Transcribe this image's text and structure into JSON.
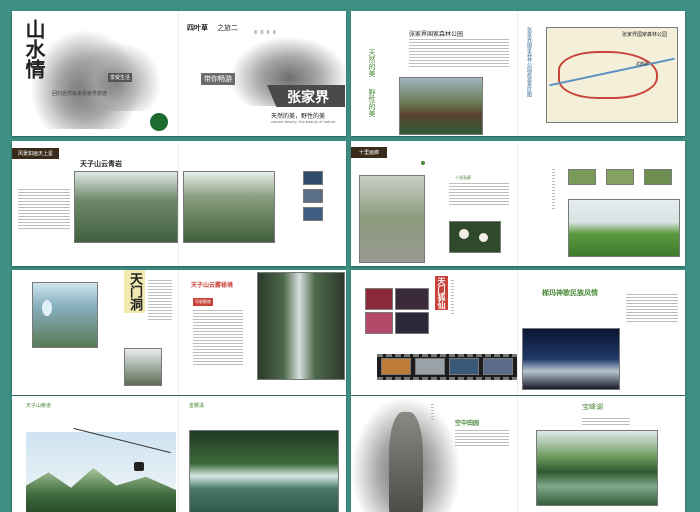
{
  "spread1": {
    "logo": "山水情",
    "side_caption": "回归自然就来张家界旅游",
    "badge": "享受生活",
    "chapter": "四叶草",
    "chapter2": "之旅二",
    "guide": "带你畅游",
    "city": "张家界",
    "slogan": "天然的美，野性的美",
    "slogan_en": "natural beauty, the beauty of nature"
  },
  "spread2": {
    "page_title": "张家界国家森林公园",
    "vertical1": "天然的美",
    "vertical2": "野性的美",
    "map_title": "张家界国家森林公园",
    "map_caption": "张家界国家森林公园旅游景区图",
    "map_label": "武陵源"
  },
  "spread3": {
    "ribbon": "风景如画天上星",
    "heading": "天子山云青岩"
  },
  "spread4": {
    "ribbon": "十里画廊",
    "sub": "十里画廊"
  },
  "spread5": {
    "title": "天门洞"
  },
  "spread6": {
    "heading": "天子山云雾秘境",
    "sub": "尽收眼底"
  },
  "spread7": {
    "title": "天门狐仙"
  },
  "spread8": {
    "title": "梯玛神歌民族风情"
  },
  "spread9": {
    "left_title": "天子山索道",
    "right_title": "金鞭溪"
  },
  "spread10": {
    "caption": "空中田园"
  },
  "spread11": {
    "caption": "宝峰湖"
  },
  "colors": {
    "background": "#3f8f84",
    "accent_red": "#c8433a",
    "accent_green": "#4c8a3a",
    "ribbon_dark": "#3a2a1a"
  }
}
